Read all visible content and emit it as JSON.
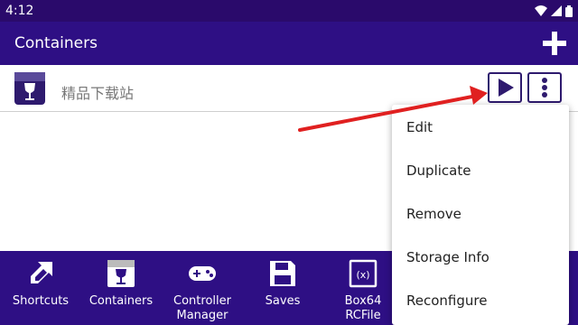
{
  "status_bar": {
    "time": "4:12"
  },
  "app_bar": {
    "title": "Containers"
  },
  "containers": [
    {
      "name": "精品下载站"
    }
  ],
  "menu": {
    "items": [
      "Edit",
      "Duplicate",
      "Remove",
      "Storage Info",
      "Reconfigure"
    ]
  },
  "bottom_nav": {
    "shortcuts": "Shortcuts",
    "containers": "Containers",
    "controller_line1": "Controller",
    "controller_line2": "Manager",
    "saves": "Saves",
    "box64_line1": "Box64",
    "box64_line2": "RCFile"
  },
  "colors": {
    "status_bar": "#2a0a6b",
    "app_bar": "#2e0f84",
    "accent": "#2e1a6e",
    "annotation_arrow": "#e02020"
  },
  "icons": {
    "add": "plus-icon",
    "run": "play-icon",
    "menu": "more-vert-icon",
    "container": "wine-glass-icon"
  }
}
